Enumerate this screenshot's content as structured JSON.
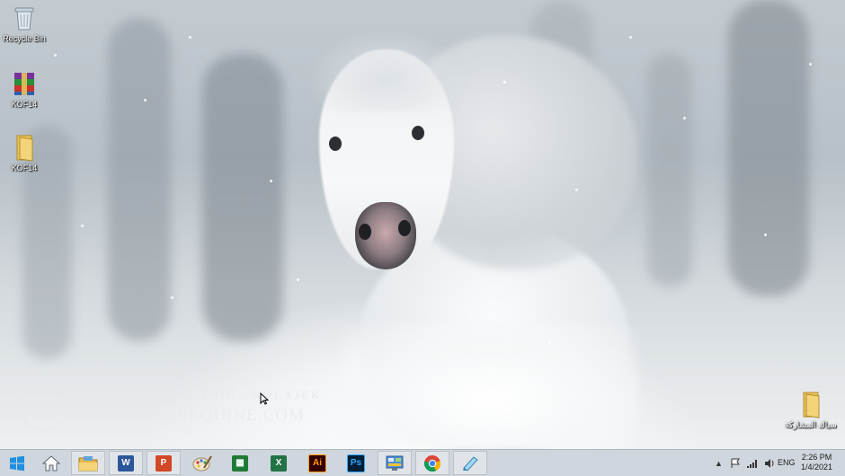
{
  "desktop": {
    "icons": [
      {
        "label": "Recycle Bin",
        "icon": "recycle-bin-icon"
      },
      {
        "label": "KOF14",
        "icon": "winrar-archive-icon"
      },
      {
        "label": "KOF14",
        "icon": "folder-icon"
      },
      {
        "label": "سياك المشاركة",
        "icon": "folder-icon"
      }
    ],
    "wallpaper": {
      "watermark_line1": "KATARZYNA OKRZESIK - KOLAJEK",
      "watermark_line2": "WWW.PHOTO-EQUINE.COM"
    }
  },
  "taskbar": {
    "start": {
      "icon": "windows-logo-icon",
      "color": "#1f8fe0"
    },
    "pinned": [
      {
        "name": "home",
        "icon": "home-icon",
        "glyph": ""
      },
      {
        "name": "file-explorer",
        "icon": "folder-icon",
        "glyph": ""
      },
      {
        "name": "word",
        "icon": "word-icon",
        "glyph": "W",
        "color": "#2b579a"
      },
      {
        "name": "powerpoint",
        "icon": "powerpoint-icon",
        "glyph": "P",
        "color": "#d24726"
      },
      {
        "name": "paint",
        "icon": "paint-palette-icon",
        "glyph": ""
      },
      {
        "name": "calculator-sheet",
        "icon": "spreadsheet-icon",
        "glyph": "▦",
        "color": "#1e7b34"
      },
      {
        "name": "excel",
        "icon": "excel-icon",
        "glyph": "X",
        "color": "#217346"
      },
      {
        "name": "illustrator",
        "icon": "illustrator-icon",
        "glyph": "Ai",
        "color": "#330000",
        "fg": "#ff9a00"
      },
      {
        "name": "photoshop",
        "icon": "photoshop-icon",
        "glyph": "Ps",
        "color": "#001e36",
        "fg": "#31a8ff"
      },
      {
        "name": "control-panel",
        "icon": "control-panel-icon",
        "glyph": ""
      },
      {
        "name": "chrome",
        "icon": "chrome-icon",
        "glyph": ""
      },
      {
        "name": "notes",
        "icon": "notepad-icon",
        "glyph": ""
      }
    ],
    "tray": {
      "language": "ENG",
      "time": "2:26 PM",
      "date": "1/4/2021"
    }
  }
}
